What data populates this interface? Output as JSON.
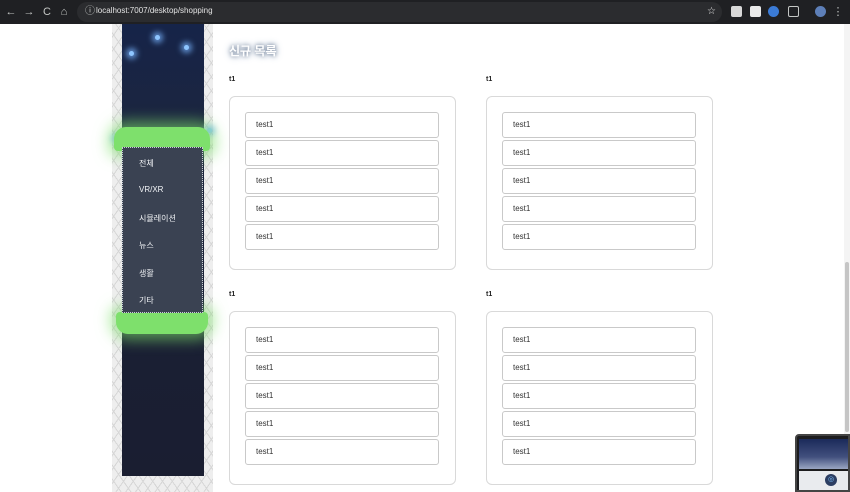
{
  "browser": {
    "back_icon": "←",
    "forward_icon": "→",
    "reload_icon": "C",
    "home_icon": "⌂",
    "url": "localhost:7007/desktop/shopping",
    "bookmark_icon": "☆",
    "menu_icon": "⋮"
  },
  "sidebar": {
    "menu_items": [
      "전체",
      "VR/XR",
      "시뮬레이션",
      "뉴스",
      "생활",
      "기타"
    ]
  },
  "main": {
    "heading": "신규 목록",
    "sections": [
      {
        "label": "t1",
        "items": [
          "test1",
          "test1",
          "test1",
          "test1",
          "test1"
        ]
      },
      {
        "label": "t1",
        "items": [
          "test1",
          "test1",
          "test1",
          "test1",
          "test1"
        ]
      },
      {
        "label": "t1",
        "items": [
          "test1",
          "test1",
          "test1",
          "test1",
          "test1"
        ]
      },
      {
        "label": "t1",
        "items": [
          "test1",
          "test1",
          "test1",
          "test1",
          "test1"
        ]
      }
    ]
  },
  "colors": {
    "panel_dark": "#1a2036",
    "menu_bg": "#3a4252",
    "glow_green": "#7ee06c"
  }
}
